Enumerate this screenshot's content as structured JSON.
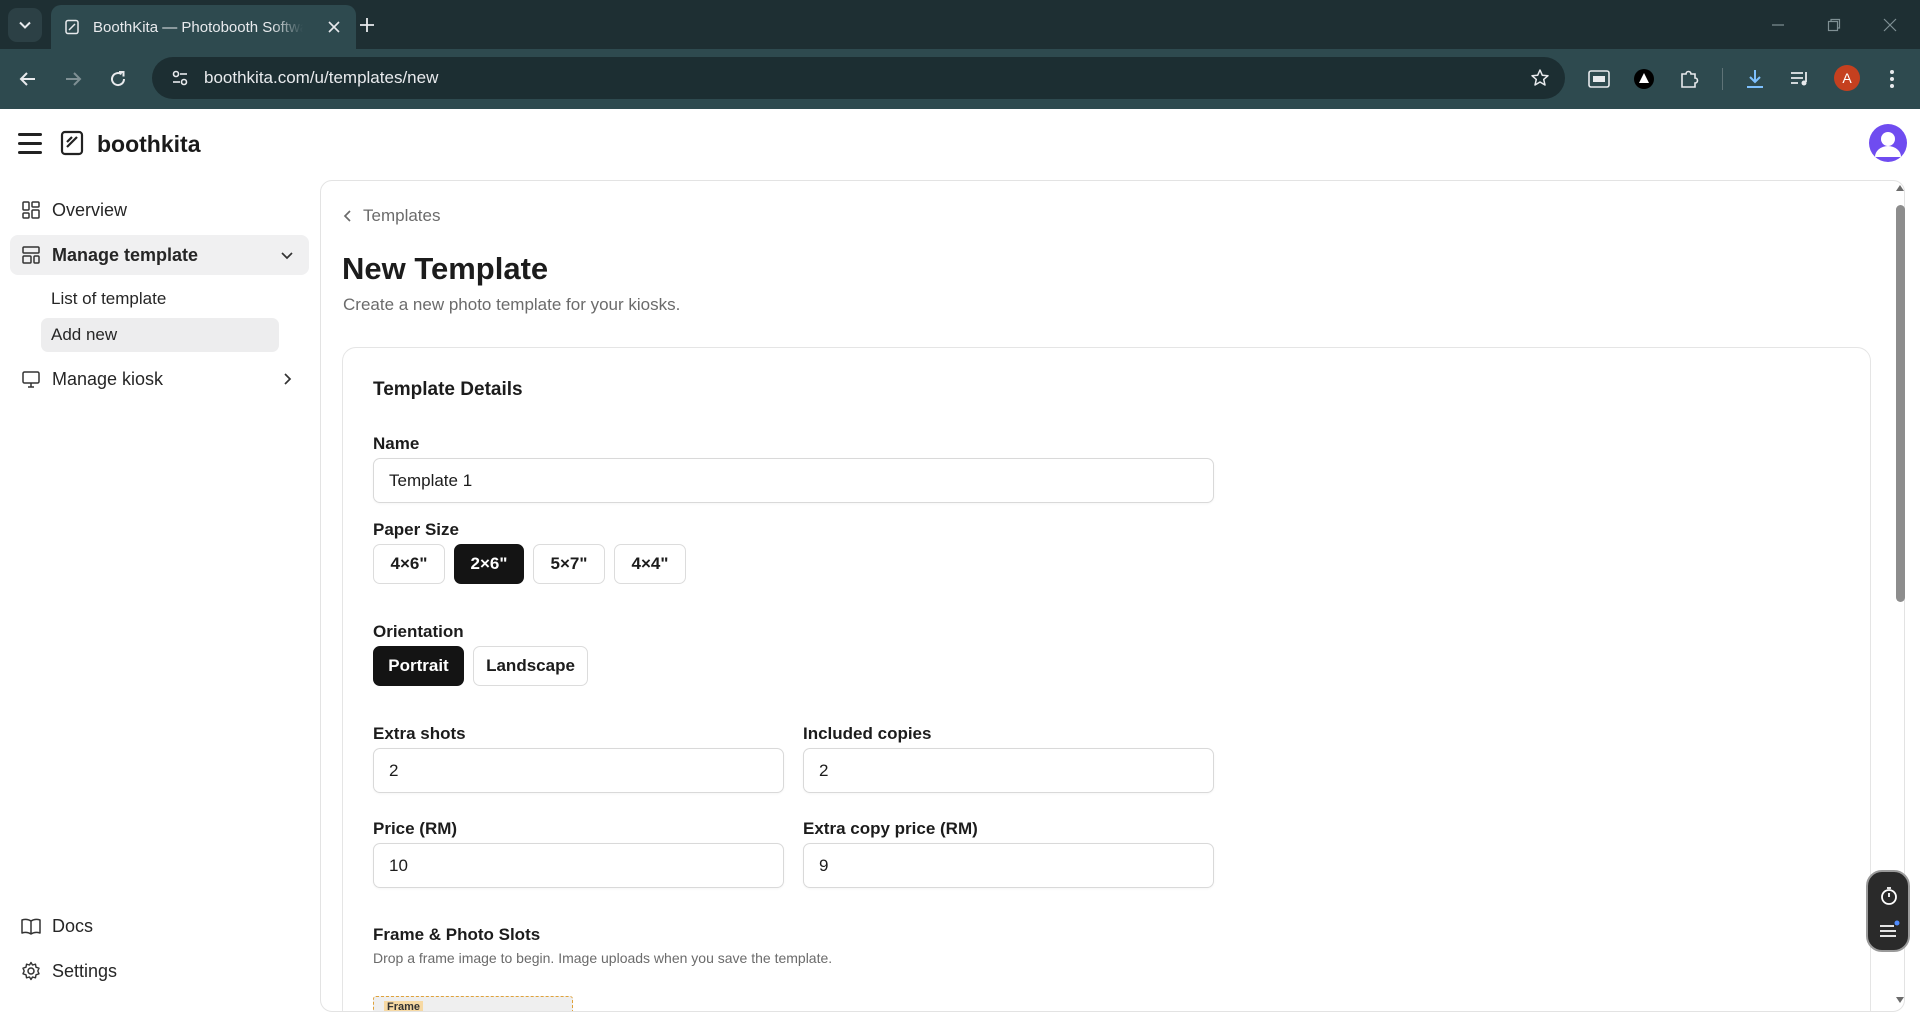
{
  "browser": {
    "tab_title": "BoothKita — Photobooth Software",
    "url": "boothkita.com/u/templates/new",
    "profile_initial": "A"
  },
  "app": {
    "brand": "boothkita"
  },
  "sidebar": {
    "overview": "Overview",
    "manage_template": "Manage template",
    "list_of_template": "List of template",
    "add_new": "Add new",
    "manage_kiosk": "Manage kiosk",
    "docs": "Docs",
    "settings": "Settings"
  },
  "page": {
    "breadcrumb": "Templates",
    "title": "New Template",
    "subtitle": "Create a new photo template for your kiosks."
  },
  "form": {
    "section_title": "Template Details",
    "name_label": "Name",
    "name_value": "Template 1",
    "paper_size_label": "Paper Size",
    "paper_sizes": [
      "4×6\"",
      "2×6\"",
      "5×7\"",
      "4×4\""
    ],
    "paper_size_selected": "2×6\"",
    "orientation_label": "Orientation",
    "orientations": [
      "Portrait",
      "Landscape"
    ],
    "orientation_selected": "Portrait",
    "extra_shots_label": "Extra shots",
    "extra_shots_value": "2",
    "included_copies_label": "Included copies",
    "included_copies_value": "2",
    "price_label": "Price (RM)",
    "price_value": "10",
    "extra_copy_price_label": "Extra copy price (RM)",
    "extra_copy_price_value": "9",
    "frame_label": "Frame & Photo Slots",
    "frame_help": "Drop a frame image to begin. Image uploads when you save the template.",
    "frame_thumb_label": "Frame"
  },
  "colors": {
    "chrome_dark": "#1e2f33",
    "chrome_toolbar": "#2e4a4f",
    "selected_fill": "#141414",
    "avatar": "#6f4cf0",
    "profile_badge": "#c5401f"
  }
}
